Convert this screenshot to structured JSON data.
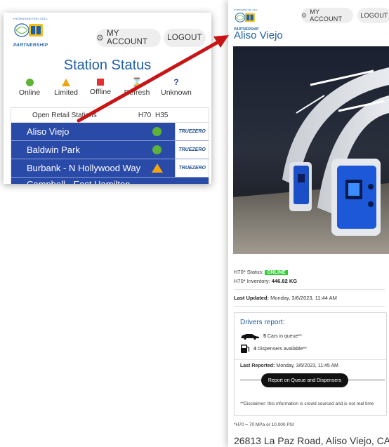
{
  "logo": {
    "top_text": "HYDROGEN FUEL CELL",
    "bottom_text": "PARTNERSHIP"
  },
  "left": {
    "account_label": "MY ACCOUNT",
    "logout_label": "LOGOUT",
    "title": "Station Status",
    "legend": [
      {
        "label": "Online",
        "icon": "green-circle-icon"
      },
      {
        "label": "Limited",
        "icon": "orange-triangle-icon"
      },
      {
        "label": "Offline",
        "icon": "red-square-icon"
      },
      {
        "label": "Refresh",
        "icon": "hourglass-icon"
      },
      {
        "label": "Unknown",
        "icon": "question-mark-icon"
      }
    ],
    "table": {
      "header": {
        "name": "Open Retail Stations",
        "h70": "H70",
        "h35": "H35"
      },
      "rows": [
        {
          "name": "Aliso Viejo",
          "status": "online",
          "provider": "TRUEZERO"
        },
        {
          "name": "Baldwin Park",
          "status": "online",
          "provider": "TRUEZERO"
        },
        {
          "name": "Burbank - N Hollywood Way",
          "status": "limited",
          "provider": "TRUEZERO"
        },
        {
          "name": "Campbell - East Hamilton",
          "status": "",
          "provider": ""
        }
      ]
    }
  },
  "right": {
    "account_label": "MY ACCOUNT",
    "logout_label": "LOGOUT",
    "station_title": "Aliso Viejo",
    "status_label": "H70* Status:",
    "status_value": "ONLINE",
    "inventory_label": "H70* Inventory:",
    "inventory_value": "446.82 KG",
    "last_updated_label": "Last Updated:",
    "last_updated_value": "Monday, 3/6/2023, 11:44 AM",
    "drivers": {
      "title": "Drivers report:",
      "cars_count": "5",
      "cars_text": "Cars in queue**",
      "dispensers_count": "4",
      "dispensers_text": "Dispensers available**",
      "last_reported_label": "Last Reported:",
      "last_reported_value": "Monday, 3/6/2023, 11:45 AM",
      "report_button": "Report on Queue and Dispensers",
      "disclaimer": "**Disclaimer: this information is crowd sourced and is not real time"
    },
    "footnote": "*H70 = 70 MPa or 10,000 PSI",
    "address": "26813 La Paz Road, Aliso Viejo, CA"
  },
  "colors": {
    "brand_blue": "#1f5fa8",
    "row_blue": "#2a4aa8",
    "online_green": "#5cb338",
    "limited_orange": "#f0a40e",
    "offline_red": "#e53030",
    "arrow_red": "#c81414",
    "badge_green": "#2ecc2e"
  }
}
